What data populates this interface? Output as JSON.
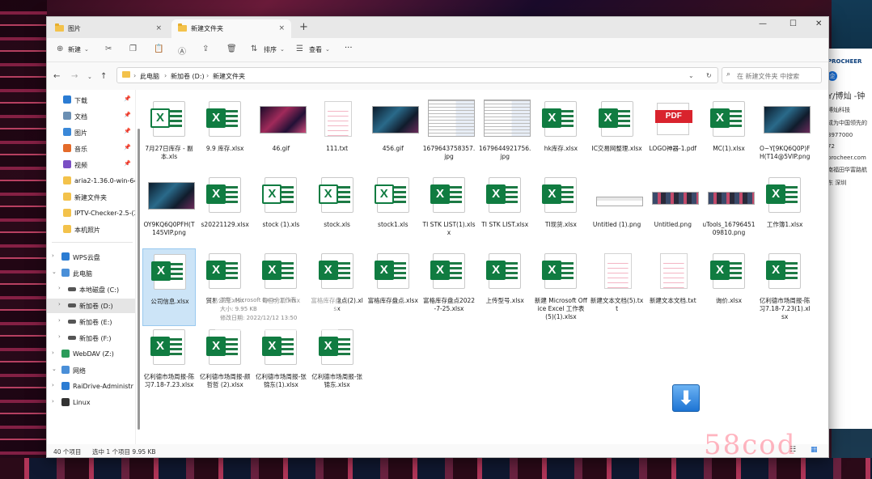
{
  "tabs": [
    {
      "label": "图片",
      "close": "×"
    },
    {
      "label": "新建文件夹",
      "close": "×"
    }
  ],
  "new_tab": "+",
  "window_controls": {
    "minimize": "—",
    "maximize": "☐",
    "close": "✕"
  },
  "toolbar": {
    "new_label": "新建",
    "sort_label": "排序",
    "view_label": "查看",
    "more": "···"
  },
  "address": {
    "crumbs": [
      "此电脑",
      "新加卷 (D:)",
      "新建文件夹"
    ],
    "search_placeholder": "在 新建文件夹 中搜索"
  },
  "nav": {
    "quick": [
      {
        "label": "下载",
        "icon": "download-icon"
      },
      {
        "label": "文档",
        "icon": "document-icon"
      },
      {
        "label": "图片",
        "icon": "pictures-icon"
      },
      {
        "label": "音乐",
        "icon": "music-icon"
      },
      {
        "label": "视频",
        "icon": "video-icon"
      },
      {
        "label": "aria2-1.36.0-win-64b",
        "icon": "folder-icon"
      },
      {
        "label": "新建文件夹",
        "icon": "folder-icon"
      },
      {
        "label": "IPTV-Checker-2.5-(2(",
        "icon": "folder-icon"
      },
      {
        "label": "本机照片",
        "icon": "folder-icon"
      }
    ],
    "tree": [
      {
        "label": "WPS云盘",
        "icon": "cloud-icon"
      },
      {
        "label": "此电脑",
        "icon": "computer-icon"
      },
      {
        "label": "本地磁盘 (C:)",
        "icon": "drive-icon"
      },
      {
        "label": "新加卷 (D:)",
        "icon": "drive-icon"
      },
      {
        "label": "新加卷 (E:)",
        "icon": "drive-icon"
      },
      {
        "label": "新加卷 (F:)",
        "icon": "drive-icon"
      },
      {
        "label": "WebDAV (Z:)",
        "icon": "network-drive-icon"
      },
      {
        "label": "网络",
        "icon": "network-icon"
      },
      {
        "label": "RaiDrive-Administr",
        "icon": "raidrive-icon"
      },
      {
        "label": "Linux",
        "icon": "linux-icon"
      }
    ]
  },
  "files": [
    {
      "name": "7月27日库存 - 副本.xls",
      "type": "xls"
    },
    {
      "name": "9.9 库存.xlsx",
      "type": "xlsx"
    },
    {
      "name": "46.gif",
      "type": "img-neon"
    },
    {
      "name": "111.txt",
      "type": "txt"
    },
    {
      "name": "456.gif",
      "type": "img-dark"
    },
    {
      "name": "1679643758357.jpg",
      "type": "img-doc"
    },
    {
      "name": "1679644921756.jpg",
      "type": "img-doc"
    },
    {
      "name": "hk库存.xlsx",
      "type": "xlsx"
    },
    {
      "name": "IC交易网整理.xlsx",
      "type": "xlsx"
    },
    {
      "name": "LOGO神器-1.pdf",
      "type": "pdf"
    },
    {
      "name": "MC(1).xlsx",
      "type": "xlsx"
    },
    {
      "name": "O~Y[9KQ6Q0P)FH(T14@5VIP.png",
      "type": "img-dark"
    },
    {
      "name": "OY9KQ6Q0PFH(T145VIP.png",
      "type": "img-dark"
    },
    {
      "name": "s20221129.xlsx",
      "type": "xlsx"
    },
    {
      "name": "stock (1).xls",
      "type": "xls"
    },
    {
      "name": "stock.xls",
      "type": "xls"
    },
    {
      "name": "stock1.xls",
      "type": "xls"
    },
    {
      "name": "TI STK LIST(1).xlsx",
      "type": "xlsx"
    },
    {
      "name": "TI STK LIST.xlsx",
      "type": "xlsx"
    },
    {
      "name": "TI现货.xlsx",
      "type": "xlsx"
    },
    {
      "name": "Untitled (1).png",
      "type": "img-shot"
    },
    {
      "name": "Untitled.png",
      "type": "img-strip"
    },
    {
      "name": "uTools_1679645109810.png",
      "type": "img-strip"
    },
    {
      "name": "工作簿1.xlsx",
      "type": "xlsx"
    },
    {
      "name": "公司信息.xlsx",
      "type": "xlsx"
    },
    {
      "name": "贸易公司.xlsx",
      "type": "xlsx"
    },
    {
      "name": "每日分析.xlsx",
      "type": "xlsx"
    },
    {
      "name": "富格库存盘点(2).xlsx",
      "type": "xlsx"
    },
    {
      "name": "富格库存盘点.xlsx",
      "type": "xlsx"
    },
    {
      "name": "富格库存盘点2022-7-25.xlsx",
      "type": "xlsx"
    },
    {
      "name": "上传型号.xlsx",
      "type": "xlsx"
    },
    {
      "name": "新建 Microsoft Office Excel 工作表(5)(1).xlsx",
      "type": "xlsx"
    },
    {
      "name": "新建文本文档(5).txt",
      "type": "txt"
    },
    {
      "name": "新建文本文档.txt",
      "type": "txt"
    },
    {
      "name": "询价.xlsx",
      "type": "xlsx"
    },
    {
      "name": "亿利德市场周报-陈习7.18-7.23(1).xlsx",
      "type": "xlsx"
    },
    {
      "name": "亿利德市场周报-陈习7.18-7.23.xlsx",
      "type": "xlsx"
    },
    {
      "name": "亿利德市场周报-颜哲哲 (2).xlsx",
      "type": "xlsx"
    },
    {
      "name": "亿利德市场周报-张锦东(1).xlsx",
      "type": "xlsx"
    },
    {
      "name": "亿利德市场周报-张锦东.xlsx",
      "type": "xlsx"
    }
  ],
  "tooltip": {
    "line1": "类型: Microsoft Excel 工作表",
    "line2": "大小: 9.95 KB",
    "line3": "修改日期: 2022/12/12 13:50"
  },
  "status": {
    "count": "40 个项目",
    "selected": "选中 1 个项目  9.95 KB"
  },
  "side_panel": {
    "brand": "PROCHEER",
    "lines": [
      "Y/博灿 -钟",
      "博灿科技",
      "成为中国领先的",
      "3977000",
      "72",
      "procheer.com",
      "南福田华富路航",
      "东 深圳"
    ]
  },
  "watermark": "58cod"
}
